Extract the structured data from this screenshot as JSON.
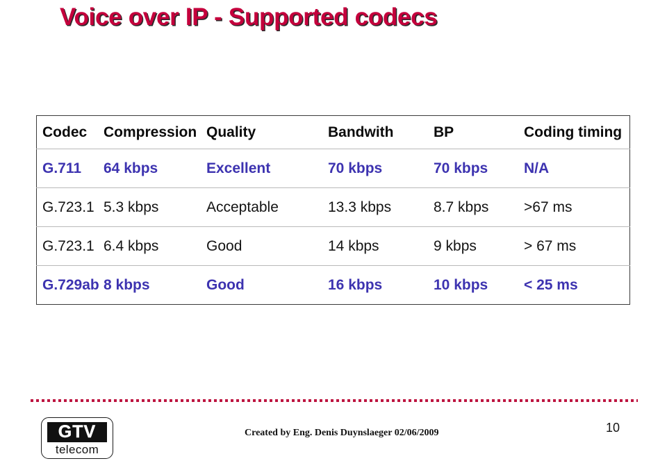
{
  "slide": {
    "title": "Voice over IP - Supported codecs",
    "page_number": "10",
    "title_color": "#c4003c",
    "accent_color": "#bd1540",
    "highlight_row_color": "#3d33b0"
  },
  "table": {
    "columns": [
      "Codec",
      "Compression",
      "Quality",
      "Bandwith",
      "BP",
      "Coding timing"
    ],
    "rows": [
      {
        "style": "blue",
        "cells": [
          "G.711",
          "64 kbps",
          "Excellent",
          "70 kbps",
          "70 kbps",
          "N/A"
        ]
      },
      {
        "style": "plain",
        "cells": [
          "G.723.1",
          "5.3 kbps",
          "Acceptable",
          "13.3 kbps",
          "8.7 kbps",
          ">67 ms"
        ]
      },
      {
        "style": "plain",
        "cells": [
          "G.723.1",
          "6.4 kbps",
          "Good",
          "14 kbps",
          "9 kbps",
          "> 67 ms"
        ]
      },
      {
        "style": "blue",
        "cells": [
          "G.729ab",
          "8 kbps",
          "Good",
          "16 kbps",
          "10 kbps",
          "< 25 ms"
        ]
      }
    ]
  },
  "footer": {
    "logo_mark": "GTV",
    "logo_word": "telecom",
    "credit": "Created by Eng. Denis Duynslaeger 02/06/2009"
  }
}
